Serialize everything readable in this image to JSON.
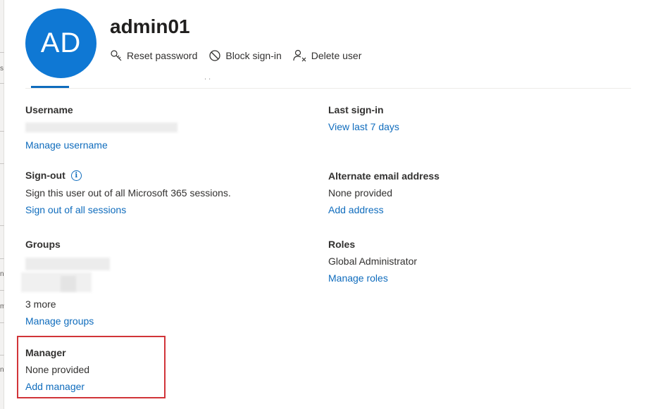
{
  "user": {
    "initials": "AD",
    "display_name": "admin01"
  },
  "actions": {
    "reset_password": "Reset password",
    "block_sign_in": "Block sign-in",
    "delete_user": "Delete user"
  },
  "left_edge": {
    "fragments": [
      "s",
      "n",
      "m",
      "n"
    ]
  },
  "username": {
    "label": "Username",
    "link": "Manage username"
  },
  "last_sign_in": {
    "label": "Last sign-in",
    "link": "View last 7 days"
  },
  "sign_out": {
    "label": "Sign-out",
    "info_glyph": "i",
    "value": "Sign this user out of all Microsoft 365 sessions.",
    "link": "Sign out of all sessions"
  },
  "alternate_email": {
    "label": "Alternate email address",
    "value": "None provided",
    "link": "Add address"
  },
  "groups": {
    "label": "Groups",
    "more": "3 more",
    "link": "Manage groups"
  },
  "roles": {
    "label": "Roles",
    "value": "Global Administrator",
    "link": "Manage roles"
  },
  "manager": {
    "label": "Manager",
    "value": "None provided",
    "link": "Add manager"
  },
  "colors": {
    "accent": "#0f6cbd",
    "avatar": "#0f78d4",
    "highlight": "#d13438"
  }
}
